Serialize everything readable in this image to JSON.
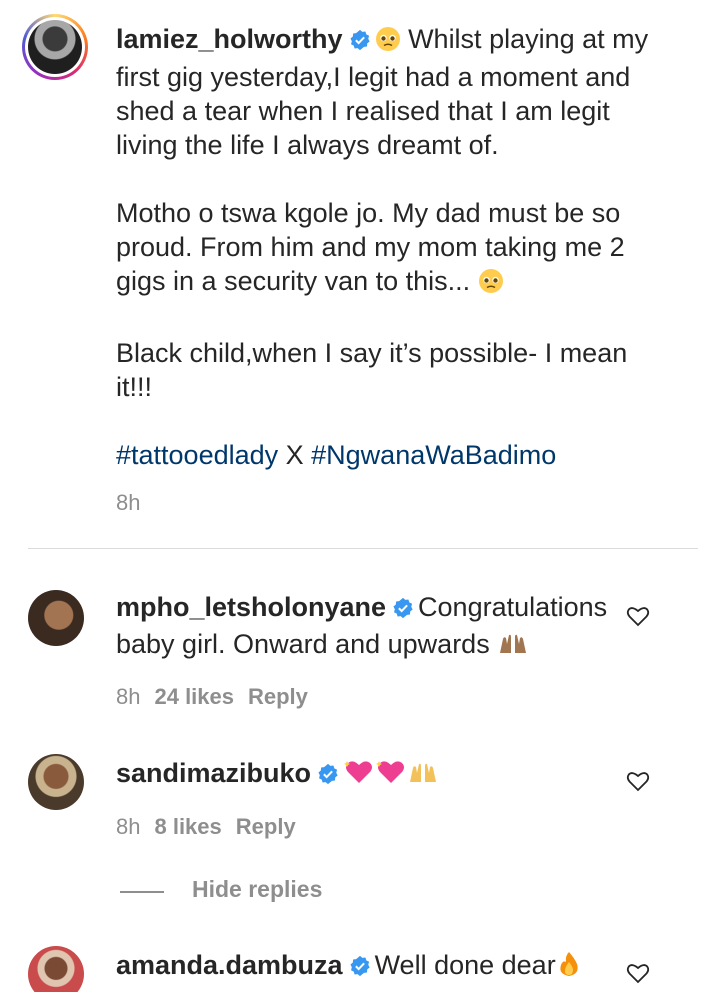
{
  "post": {
    "username": "lamiez_holworthy",
    "paragraphs": [
      "Whilst playing at my first gig yesterday,I legit had a moment and shed a tear when I realised that I am legit living the life I always dreamt of.",
      "Motho o tswa kgole jo. My dad must be so proud. From him and my mom taking me 2 gigs in a security van to this...",
      "Black child,when I say it’s possible- I mean it!!!"
    ],
    "line1_rest": "Whilst playing at my",
    "line2": "first gig yesterday,I legit had a moment and",
    "line3": "shed a tear when I realised that I am legit",
    "line4": "living the life I always dreamt of.",
    "line5": "Motho o tswa kgole jo. My dad must be so",
    "line6": "proud. From him and my mom taking me 2",
    "line7": "gigs in a security van to this...",
    "line8": "Black child,when I say it’s possible- I mean",
    "line9": "it!!!",
    "hashtag1": "#tattooedlady",
    "hashtag_sep": " X ",
    "hashtag2": "#NgwanaWaBadimo",
    "time": "8h"
  },
  "comments": [
    {
      "username": "mpho_letsholonyane",
      "text_line1": "Congratulations",
      "text_line2": "baby girl. Onward and upwards",
      "time": "8h",
      "likes": "24 likes",
      "reply": "Reply"
    },
    {
      "username": "sandimazibuko",
      "time": "8h",
      "likes": "8 likes",
      "reply": "Reply"
    },
    {
      "username": "amanda.dambuza",
      "text": "Well done dear"
    }
  ],
  "hide_replies": "Hide replies",
  "colors": {
    "text": "#262626",
    "muted": "#8e8e8e",
    "hashtag": "#00376b",
    "verified": "#3897f0"
  },
  "icons": {
    "verified": "verified-badge-icon",
    "heart": "heart-outline-icon"
  }
}
